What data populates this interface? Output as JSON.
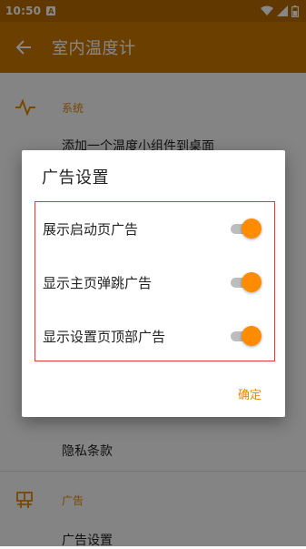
{
  "status_bar": {
    "time": "10:50",
    "notification_icon": "A"
  },
  "app_bar": {
    "title": "室内温度计",
    "back_icon": "arrow-left"
  },
  "settings": {
    "section_system": {
      "label": "系统",
      "icon": "waveform"
    },
    "item_add_widget": "添加一个温度小组件到桌面",
    "item_privacy": "隐私条款",
    "section_ads": {
      "label": "广告",
      "icon": "ad-panel"
    },
    "item_ad_settings": "广告设置"
  },
  "dialog": {
    "title": "广告设置",
    "options": [
      {
        "label": "展示启动页广告",
        "enabled": true
      },
      {
        "label": "显示主页弹跳广告",
        "enabled": true
      },
      {
        "label": "显示设置页顶部广告",
        "enabled": true
      }
    ],
    "confirm": "确定"
  },
  "colors": {
    "app_bar": "#c97700",
    "status_bar": "#b86a00",
    "accent": "#ff8c00",
    "highlight_border": "#e53935"
  }
}
